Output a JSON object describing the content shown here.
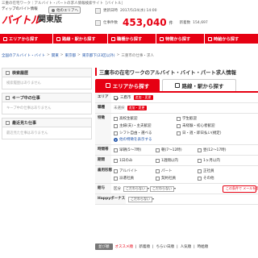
{
  "tagline": "三重の在宅ワーク｜アルバイト・パートの求人情報検索サイト［バイトル］",
  "header": {
    "logo_small": "ディップのバイト情報",
    "logo_main": "バイトル",
    "region": "関東版",
    "area_button": "他のエリアへ",
    "update_label": "更新日時",
    "update_value": "2017/5/24(水) 14:00",
    "jobs_label": "仕事件数",
    "jobs_count": "453,040",
    "jobs_unit": "件",
    "new_label": "新着数",
    "new_count": "154,697"
  },
  "nav": [
    {
      "label": "エリアから探す"
    },
    {
      "label": "路線・駅から探す"
    },
    {
      "label": "職種から探す"
    },
    {
      "label": "特徴から探す"
    },
    {
      "label": "時給から探す"
    }
  ],
  "breadcrumb": [
    "全国のアルバイト・バイト",
    "関東",
    "東京都",
    "東京都下(23区以外)",
    "三重市の仕事・求人"
  ],
  "sidebar": {
    "boxes": [
      {
        "title": "検索履歴",
        "body": "検索履歴はありません"
      },
      {
        "title": "キープ中の仕事",
        "body": "キープ中の仕事はありません"
      },
      {
        "title": "最近見た仕事",
        "body": "最近見た仕事はありません"
      }
    ]
  },
  "main": {
    "title": "三鷹市の在宅ワークのアルバイト・バイト・パート求人情報",
    "tab_area": "エリアから探す",
    "tab_line": "路線・駅から探す",
    "area": {
      "label": "エリア",
      "value": "三鷹市",
      "badge": "追加・変更"
    },
    "job": {
      "label": "職種",
      "value": "未選択",
      "badge": "追加・変更"
    },
    "features": {
      "label": "特徴",
      "items": [
        "高校生歓迎",
        "学生歓迎",
        "主婦(夫)・主夫歓迎",
        "未経験・初心者歓迎",
        "シフト自由・選べる",
        "日・週・即日払い(規定)"
      ],
      "more": "他の特徴を表示する"
    },
    "times": {
      "label": "時間帯",
      "items": [
        "早朝(5〜7時)",
        "朝(7〜12時)",
        "昼(12〜17時)"
      ]
    },
    "period": {
      "label": "期間",
      "items": [
        "1日のみ",
        "1週間以内",
        "1ヶ月以内"
      ]
    },
    "employment": {
      "label": "雇用形態",
      "items": [
        "アルバイト",
        "パート",
        "正社員",
        "派遣社員",
        "契約社員",
        "その他"
      ]
    },
    "pay": {
      "label": "給与",
      "kind_label": "区分",
      "min": "こだわらない",
      "max": "こだわらない",
      "save": "この条件で メールを受け取る"
    },
    "bonus": {
      "label": "Happyボーナス",
      "value": "こだわらない"
    }
  },
  "footer": {
    "sort_button": "並び順",
    "links": [
      "オススメ順",
      "新着順",
      "ちらい日順",
      "人気順",
      "時給順"
    ]
  }
}
